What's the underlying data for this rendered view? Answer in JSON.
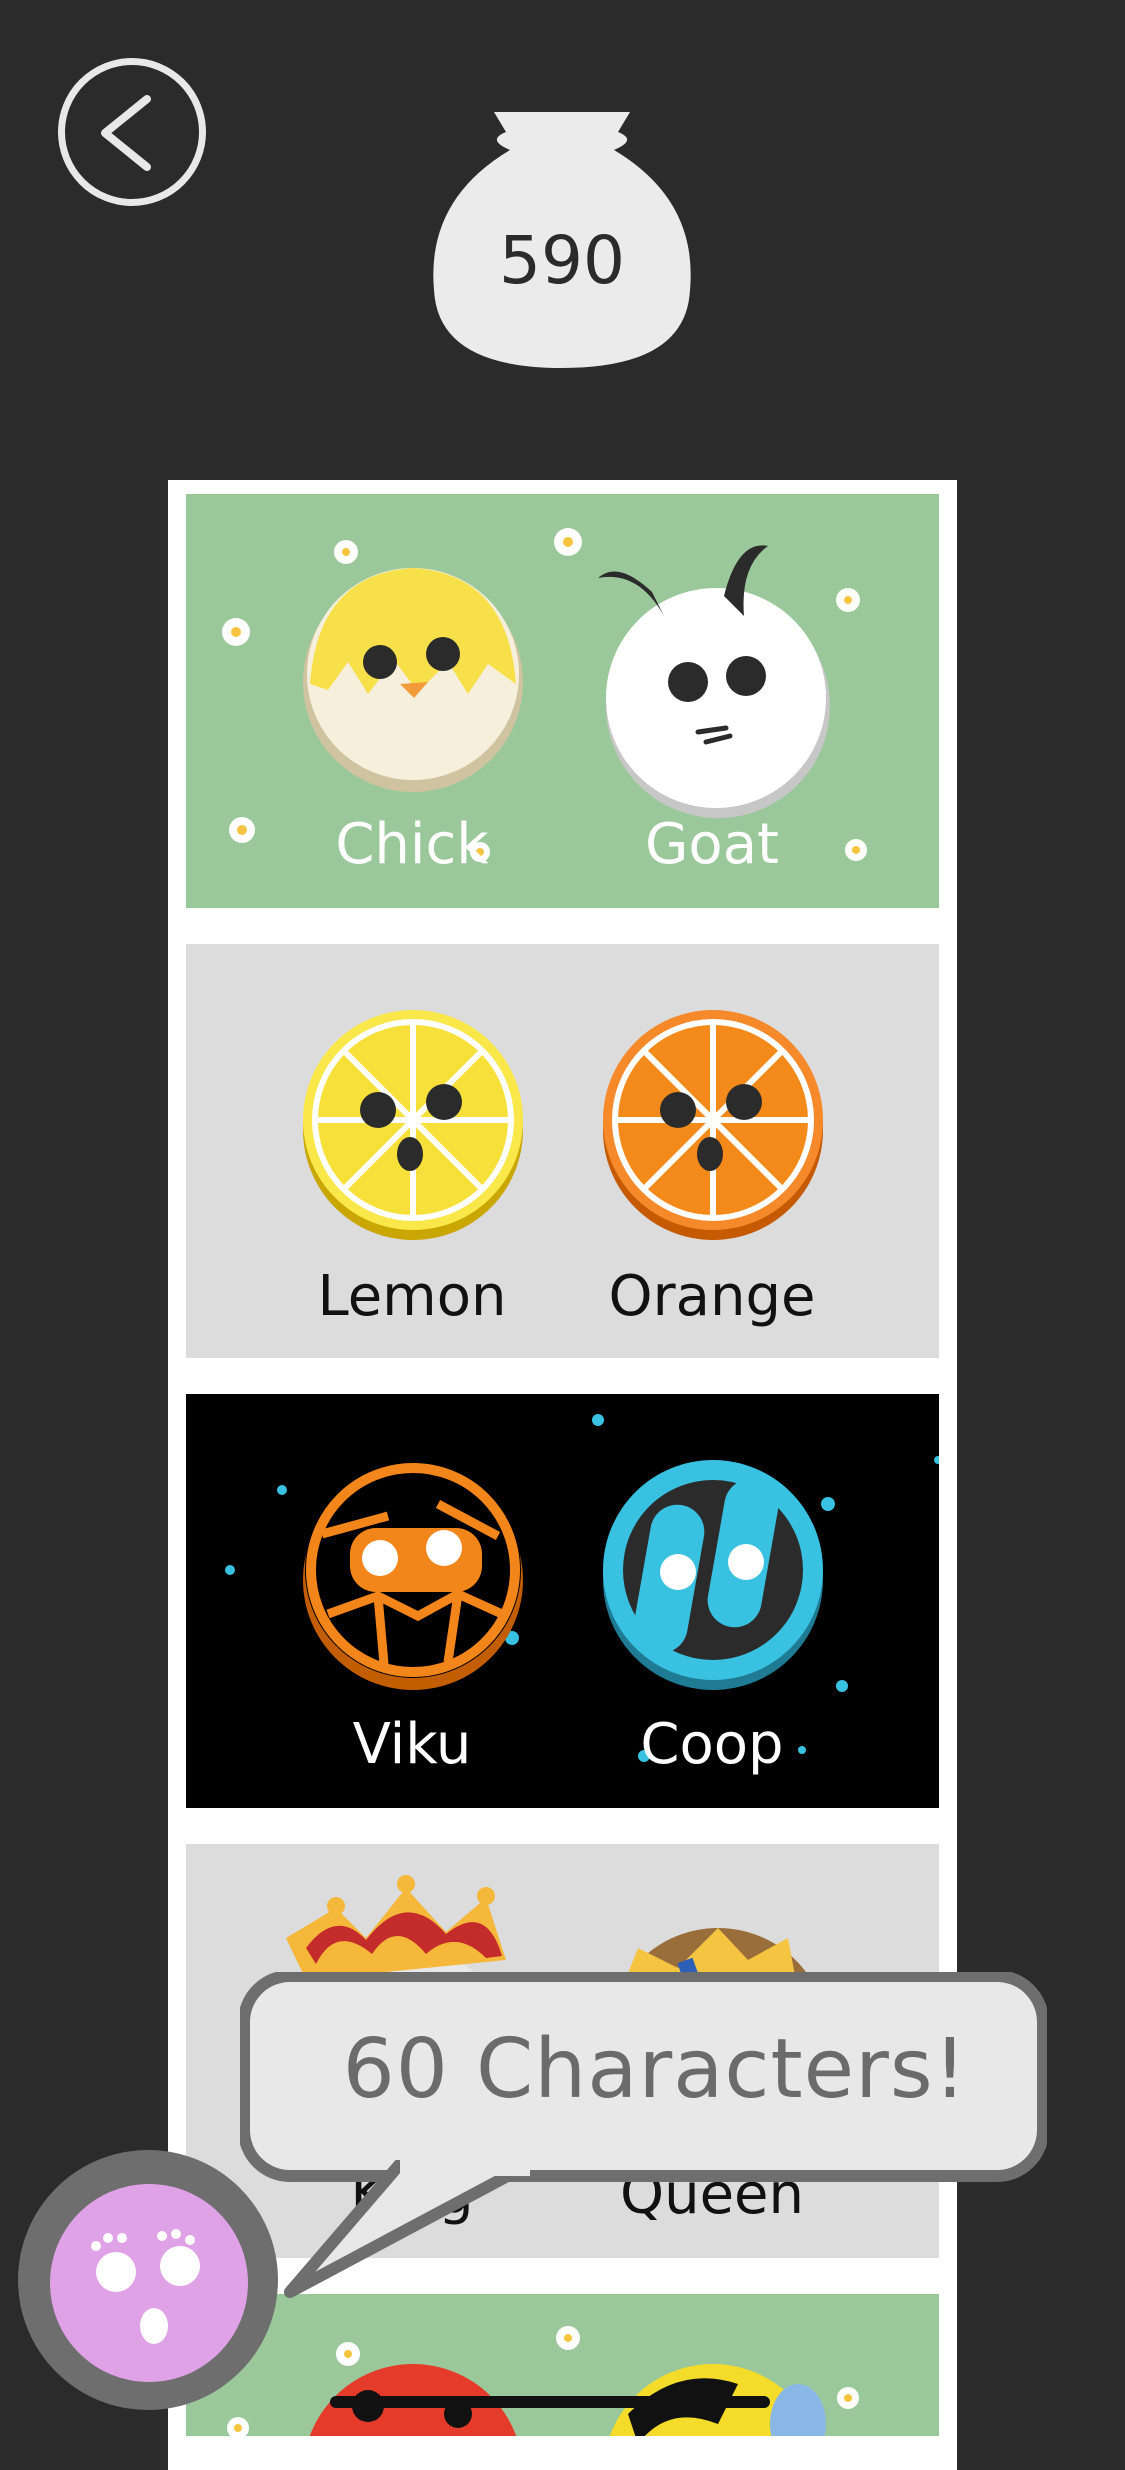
{
  "header": {
    "coins": "590"
  },
  "characters": [
    {
      "group": "farm",
      "left": "Chick",
      "right": "Goat",
      "bg": "#9bc89a",
      "text_color": "#ffffff"
    },
    {
      "group": "fruit",
      "left": "Lemon",
      "right": "Orange",
      "bg": "#dcdcdc",
      "text_color": "#111111"
    },
    {
      "group": "space",
      "left": "Viku",
      "right": "Coop",
      "bg": "#000000",
      "text_color": "#ffffff"
    },
    {
      "group": "royal",
      "left": "King",
      "right": "Queen",
      "bg": "#dcdcdc",
      "text_color": "#111111"
    },
    {
      "group": "bugs",
      "bg": "#9bc89a"
    }
  ],
  "promo": {
    "text": "60  Characters!"
  },
  "colors": {
    "background": "#2b2b2b",
    "mascot": "#dfa2e6"
  }
}
